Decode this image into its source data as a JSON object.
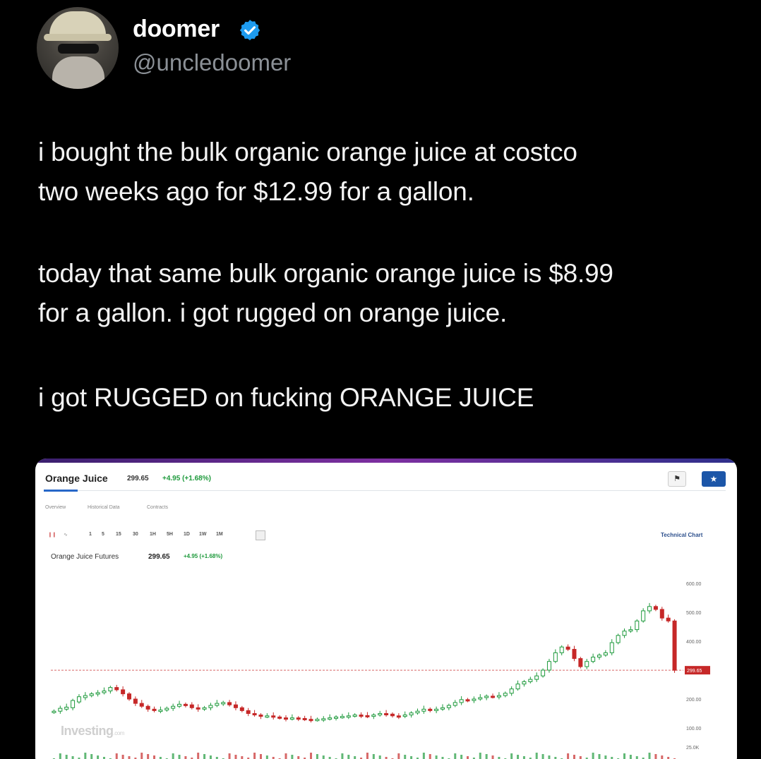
{
  "tweet": {
    "display_name": "doomer",
    "verified_icon": "verified-badge-icon",
    "handle": "@uncledoomer",
    "lines": [
      "i bought the bulk organic orange juice at costco",
      "two weeks ago for $12.99 for a gallon.",
      "today that same bulk organic orange juice is $8.99",
      "for a gallon. i got rugged on orange juice.",
      "i got RUGGED on fucking ORANGE JUICE"
    ]
  },
  "card": {
    "title": "Orange Juice",
    "price": "299.65",
    "change": "+4.95 (+1.68%)",
    "tabs": [
      "Overview",
      "Historical Data",
      "Contracts"
    ],
    "timeframes": [
      "1",
      "5",
      "15",
      "30",
      "1H",
      "5H",
      "1D",
      "1W",
      "1M"
    ],
    "technical_chart": "Technical Chart",
    "futures_label": "Orange Juice Futures",
    "futures_price": "299.65",
    "futures_change": "+4.95 (+1.68%)",
    "watermark": "Investing",
    "watermark_suffix": ".com",
    "colors": {
      "up": "#1e9a3c",
      "down": "#c62828",
      "accent": "#1c56a8"
    }
  },
  "chart_data": {
    "type": "candlestick",
    "title": "Orange Juice Futures",
    "y_ticks": [
      "600.00",
      "500.00",
      "400.00",
      "299.65",
      "200.00",
      "100.00",
      "25.0K"
    ],
    "ylim": [
      0,
      640
    ],
    "last_price_label": "299.65",
    "candles": [
      {
        "o": 155,
        "c": 158
      },
      {
        "o": 158,
        "c": 168
      },
      {
        "o": 165,
        "c": 172
      },
      {
        "o": 170,
        "c": 195
      },
      {
        "o": 190,
        "c": 208
      },
      {
        "o": 205,
        "c": 212
      },
      {
        "o": 212,
        "c": 218
      },
      {
        "o": 218,
        "c": 222
      },
      {
        "o": 222,
        "c": 228
      },
      {
        "o": 228,
        "c": 240
      },
      {
        "o": 240,
        "c": 232
      },
      {
        "o": 232,
        "c": 218
      },
      {
        "o": 218,
        "c": 200
      },
      {
        "o": 200,
        "c": 185
      },
      {
        "o": 185,
        "c": 175
      },
      {
        "o": 175,
        "c": 165
      },
      {
        "o": 165,
        "c": 160
      },
      {
        "o": 160,
        "c": 162
      },
      {
        "o": 162,
        "c": 168
      },
      {
        "o": 168,
        "c": 175
      },
      {
        "o": 175,
        "c": 182
      },
      {
        "o": 182,
        "c": 180
      },
      {
        "o": 180,
        "c": 170
      },
      {
        "o": 170,
        "c": 165
      },
      {
        "o": 165,
        "c": 170
      },
      {
        "o": 170,
        "c": 178
      },
      {
        "o": 178,
        "c": 185
      },
      {
        "o": 185,
        "c": 188
      },
      {
        "o": 188,
        "c": 180
      },
      {
        "o": 180,
        "c": 170
      },
      {
        "o": 170,
        "c": 160
      },
      {
        "o": 160,
        "c": 150
      },
      {
        "o": 150,
        "c": 145
      },
      {
        "o": 145,
        "c": 140
      },
      {
        "o": 140,
        "c": 142
      },
      {
        "o": 142,
        "c": 138
      },
      {
        "o": 138,
        "c": 135
      },
      {
        "o": 135,
        "c": 132
      },
      {
        "o": 132,
        "c": 135
      },
      {
        "o": 135,
        "c": 133
      },
      {
        "o": 133,
        "c": 130
      },
      {
        "o": 130,
        "c": 128
      },
      {
        "o": 128,
        "c": 130
      },
      {
        "o": 130,
        "c": 132
      },
      {
        "o": 132,
        "c": 135
      },
      {
        "o": 135,
        "c": 138
      },
      {
        "o": 138,
        "c": 140
      },
      {
        "o": 140,
        "c": 142
      },
      {
        "o": 142,
        "c": 145
      },
      {
        "o": 145,
        "c": 143
      },
      {
        "o": 143,
        "c": 140
      },
      {
        "o": 140,
        "c": 145
      },
      {
        "o": 145,
        "c": 150
      },
      {
        "o": 150,
        "c": 148
      },
      {
        "o": 148,
        "c": 142
      },
      {
        "o": 142,
        "c": 140
      },
      {
        "o": 140,
        "c": 145
      },
      {
        "o": 145,
        "c": 152
      },
      {
        "o": 152,
        "c": 158
      },
      {
        "o": 158,
        "c": 165
      },
      {
        "o": 165,
        "c": 160
      },
      {
        "o": 160,
        "c": 165
      },
      {
        "o": 165,
        "c": 170
      },
      {
        "o": 170,
        "c": 178
      },
      {
        "o": 178,
        "c": 188
      },
      {
        "o": 188,
        "c": 198
      },
      {
        "o": 198,
        "c": 195
      },
      {
        "o": 195,
        "c": 200
      },
      {
        "o": 200,
        "c": 205
      },
      {
        "o": 205,
        "c": 210
      },
      {
        "o": 210,
        "c": 208
      },
      {
        "o": 208,
        "c": 212
      },
      {
        "o": 212,
        "c": 220
      },
      {
        "o": 220,
        "c": 235
      },
      {
        "o": 235,
        "c": 252
      },
      {
        "o": 252,
        "c": 260
      },
      {
        "o": 260,
        "c": 268
      },
      {
        "o": 268,
        "c": 280
      },
      {
        "o": 280,
        "c": 300
      },
      {
        "o": 300,
        "c": 330
      },
      {
        "o": 330,
        "c": 360
      },
      {
        "o": 360,
        "c": 380
      },
      {
        "o": 380,
        "c": 372
      },
      {
        "o": 372,
        "c": 340
      },
      {
        "o": 340,
        "c": 312
      },
      {
        "o": 312,
        "c": 330
      },
      {
        "o": 330,
        "c": 345
      },
      {
        "o": 345,
        "c": 352
      },
      {
        "o": 352,
        "c": 360
      },
      {
        "o": 360,
        "c": 395
      },
      {
        "o": 395,
        "c": 420
      },
      {
        "o": 420,
        "c": 435
      },
      {
        "o": 435,
        "c": 440
      },
      {
        "o": 440,
        "c": 470
      },
      {
        "o": 470,
        "c": 505
      },
      {
        "o": 505,
        "c": 520
      },
      {
        "o": 520,
        "c": 510
      },
      {
        "o": 510,
        "c": 480
      },
      {
        "o": 480,
        "c": 470
      },
      {
        "o": 470,
        "c": 299.65
      }
    ]
  }
}
